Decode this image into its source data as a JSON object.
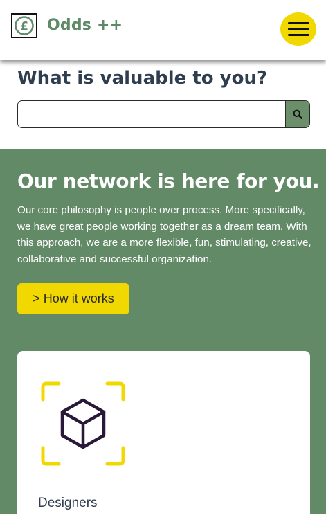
{
  "header": {
    "logo_icon": "pound-coin-icon",
    "logo_text": "Odds ++",
    "menu_icon": "hamburger-menu-icon"
  },
  "search": {
    "title": "What is valuable to you?",
    "placeholder": "",
    "value": "",
    "button_icon": "search-icon"
  },
  "network": {
    "title": "Our network is here for you.",
    "body": "Our core philosophy is people over process. More specifically, we have great people working together as a dream team. With this approach, we are a more flexible, fun, stimulating, creative, collaborative and successful organization.",
    "cta_label": "> How it works"
  },
  "cards": [
    {
      "icon": "cube-icon",
      "label": "Designers"
    }
  ],
  "colors": {
    "brand_green": "#638a67",
    "logo_green": "#5f8a67",
    "accent_yellow": "#f0d800",
    "heading_navy": "#2f3e4f",
    "icon_purple": "#2a1838"
  }
}
